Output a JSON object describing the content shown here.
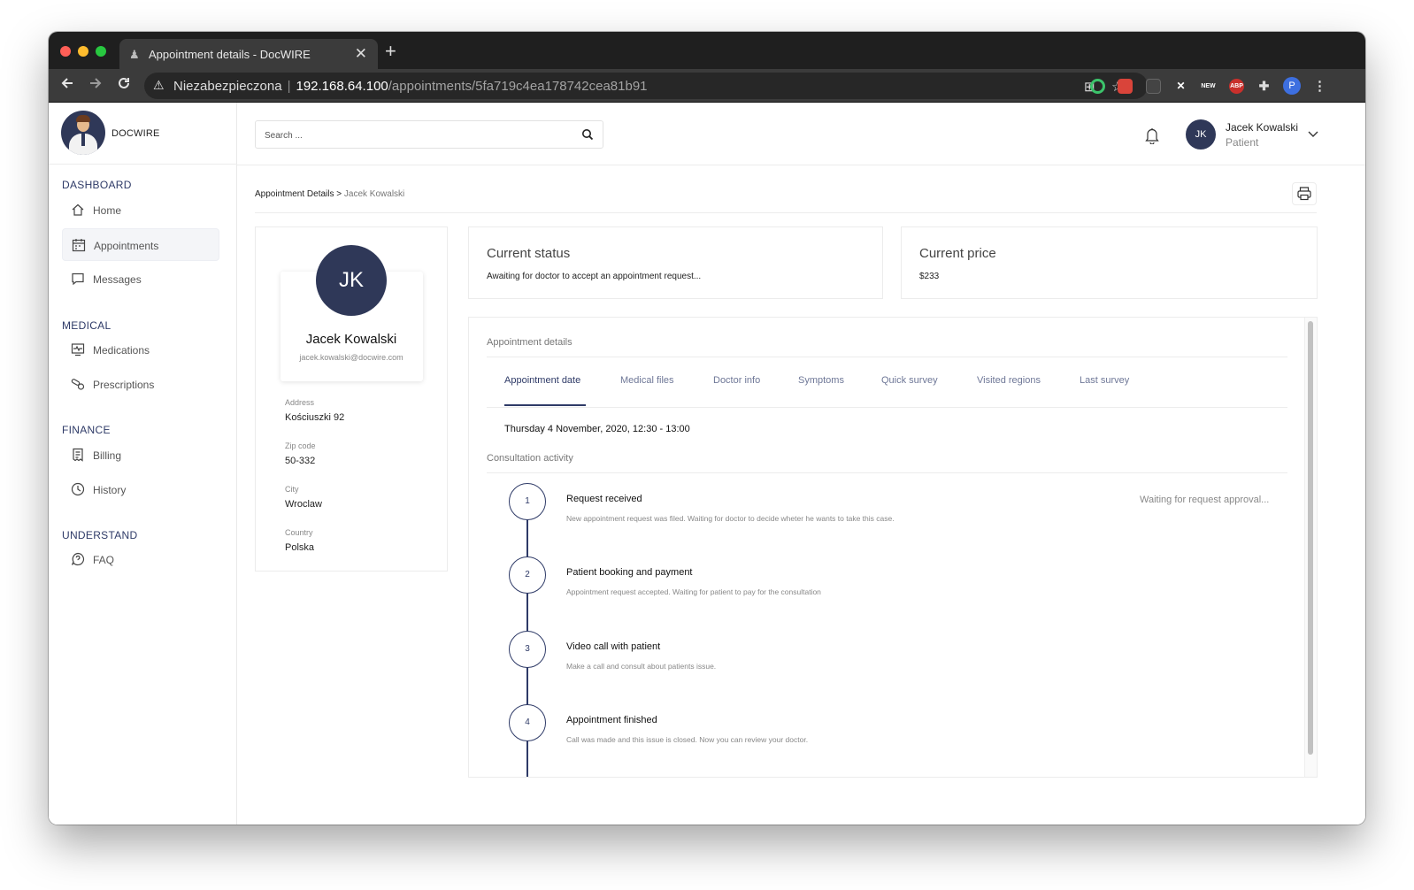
{
  "browser": {
    "tab_title": "Appointment details - DocWIRE",
    "tab_close": "✕",
    "new_tab": "+",
    "security_label": "Niezabezpieczona",
    "url_host": "192.168.64.100",
    "url_path": "/appointments/5fa719c4ea178742cea81b91",
    "profile_initial": "P",
    "ext_new": "NEW",
    "ext_abp": "ABP",
    "ext_x": "✕",
    "colors": {
      "traffic_red": "#ff5f57",
      "traffic_yellow": "#febc2e",
      "traffic_green": "#28c840"
    }
  },
  "app": {
    "brand_name": "DOCWIRE",
    "accent": "#2e3a67"
  },
  "sidebar": {
    "sections": [
      {
        "title": "DASHBOARD",
        "items": [
          {
            "label": "Home",
            "icon": "home-icon"
          },
          {
            "label": "Appointments",
            "icon": "calendar-icon",
            "active": true
          },
          {
            "label": "Messages",
            "icon": "message-icon"
          }
        ]
      },
      {
        "title": "MEDICAL",
        "items": [
          {
            "label": "Medications",
            "icon": "monitor-heart-icon"
          },
          {
            "label": "Prescriptions",
            "icon": "pills-icon"
          }
        ]
      },
      {
        "title": "FINANCE",
        "items": [
          {
            "label": "Billing",
            "icon": "receipt-icon"
          },
          {
            "label": "History",
            "icon": "clock-icon"
          }
        ]
      },
      {
        "title": "UNDERSTAND",
        "items": [
          {
            "label": "FAQ",
            "icon": "question-icon"
          }
        ]
      }
    ]
  },
  "header": {
    "search_placeholder": "Search ...",
    "user_initials": "JK",
    "user_name": "Jacek Kowalski",
    "user_role": "Patient"
  },
  "breadcrumb": {
    "parent": "Appointment Details",
    "separator": ">",
    "current": "Jacek Kowalski"
  },
  "profile": {
    "initials": "JK",
    "name": "Jacek Kowalski",
    "email": "jacek.kowalski@docwire.com",
    "fields": [
      {
        "label": "Address",
        "value": "Kościuszki 92"
      },
      {
        "label": "Zip code",
        "value": "50-332"
      },
      {
        "label": "City",
        "value": "Wroclaw"
      },
      {
        "label": "Country",
        "value": "Polska"
      }
    ]
  },
  "status_card": {
    "heading": "Current status",
    "value": "Awaiting for doctor to accept an appointment request..."
  },
  "price_card": {
    "heading": "Current price",
    "value": "$233"
  },
  "details": {
    "title": "Appointment details",
    "tabs": [
      "Appointment date",
      "Medical files",
      "Doctor info",
      "Symptoms",
      "Quick survey",
      "Visited regions",
      "Last survey"
    ],
    "active_tab": "Appointment date",
    "date": "Thursday 4 November, 2020, 12:30 - 13:00",
    "consultation_title": "Consultation activity",
    "first_step_status": "Waiting for request approval...",
    "steps": [
      {
        "number": "1",
        "title": "Request received",
        "description": "New appointment request was filed. Waiting for doctor to decide wheter he wants to take this case."
      },
      {
        "number": "2",
        "title": "Patient booking and payment",
        "description": "Appointment request accepted. Waiting for patient to pay for the consultation"
      },
      {
        "number": "3",
        "title": "Video call with patient",
        "description": "Make a call and consult about patients issue."
      },
      {
        "number": "4",
        "title": "Appointment finished",
        "description": "Call was made and this issue is closed. Now you can review your doctor."
      }
    ]
  }
}
